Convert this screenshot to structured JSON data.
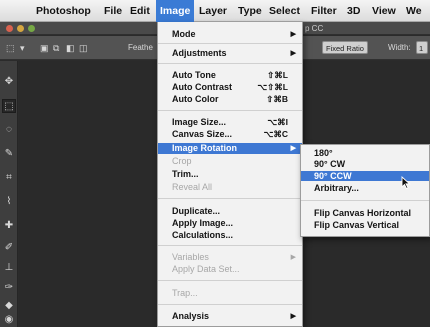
{
  "menubar": {
    "items": [
      "Photoshop",
      "File",
      "Edit",
      "Image",
      "Layer",
      "Type",
      "Select",
      "Filter",
      "3D",
      "View",
      "We"
    ],
    "active_index": 3
  },
  "window": {
    "title": "p CC"
  },
  "options_bar": {
    "feather_label": "Feathe",
    "style_value": "Fixed Ratio",
    "width_label": "Width:",
    "width_value": "1"
  },
  "image_menu": {
    "mode": "Mode",
    "adjustments": "Adjustments",
    "auto_tone": "Auto Tone",
    "auto_tone_sc": "⇧⌘L",
    "auto_contrast": "Auto Contrast",
    "auto_contrast_sc": "⌥⇧⌘L",
    "auto_color": "Auto Color",
    "auto_color_sc": "⇧⌘B",
    "image_size": "Image Size...",
    "image_size_sc": "⌥⌘I",
    "canvas_size": "Canvas Size...",
    "canvas_size_sc": "⌥⌘C",
    "image_rotation": "Image Rotation",
    "crop": "Crop",
    "trim": "Trim...",
    "reveal_all": "Reveal All",
    "duplicate": "Duplicate...",
    "apply_image": "Apply Image...",
    "calculations": "Calculations...",
    "variables": "Variables",
    "apply_data_set": "Apply Data Set...",
    "trap": "Trap...",
    "analysis": "Analysis"
  },
  "rotation_submenu": {
    "r180": "180°",
    "r90cw": "90° CW",
    "r90ccw": "90° CCW",
    "arbitrary": "Arbitrary...",
    "flip_h": "Flip Canvas Horizontal",
    "flip_v": "Flip Canvas Vertical"
  },
  "colors": {
    "menu_highlight": "#3e78d3",
    "menubar_active": "#3a7bd5",
    "workspace": "#2a2a2a"
  }
}
